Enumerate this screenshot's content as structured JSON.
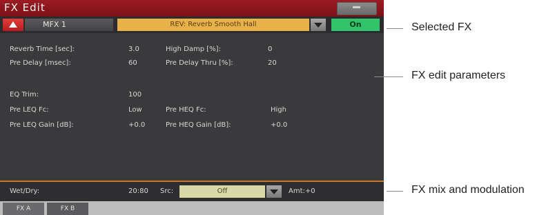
{
  "window": {
    "title": "FX Edit"
  },
  "fx_bar": {
    "mfx_label": "MFX 1",
    "selected_fx": "REV: Reverb Smooth Hall",
    "on_label": "On"
  },
  "params": {
    "reverb_time_label": "Reverb Time [sec]:",
    "reverb_time_value": "3.0",
    "high_damp_label": "High Damp [%]:",
    "high_damp_value": "0",
    "pre_delay_label": "Pre Delay [msec]:",
    "pre_delay_value": "60",
    "pre_delay_thru_label": "Pre Delay Thru [%]:",
    "pre_delay_thru_value": "20",
    "eq_trim_label": "EQ Trim:",
    "eq_trim_value": "100",
    "pre_leq_fc_label": "Pre LEQ Fc:",
    "pre_leq_fc_value": "Low",
    "pre_heq_fc_label": "Pre HEQ Fc:",
    "pre_heq_fc_value": "High",
    "pre_leq_gain_label": "Pre LEQ Gain [dB]:",
    "pre_leq_gain_value": "+0.0",
    "pre_heq_gain_label": "Pre HEQ Gain [dB]:",
    "pre_heq_gain_value": "+0.0"
  },
  "mix": {
    "wet_dry_label": "Wet/Dry:",
    "wet_dry_value": "20:80",
    "src_label": "Src:",
    "src_value": "Off",
    "amt_label": "Amt:+0"
  },
  "tabs": [
    "FX A",
    "FX B"
  ],
  "callouts": {
    "selected_fx": "Selected FX",
    "edit_params": "FX edit parameters",
    "mix_mod": "FX mix and modulation"
  },
  "colors": {
    "title_bar": "#8b1a1f",
    "panel": "#3a3a3c",
    "fx_select": "#e8b24a",
    "on_button": "#32c46a",
    "src_select": "#d9d9a8",
    "divider": "#c77a2a"
  }
}
